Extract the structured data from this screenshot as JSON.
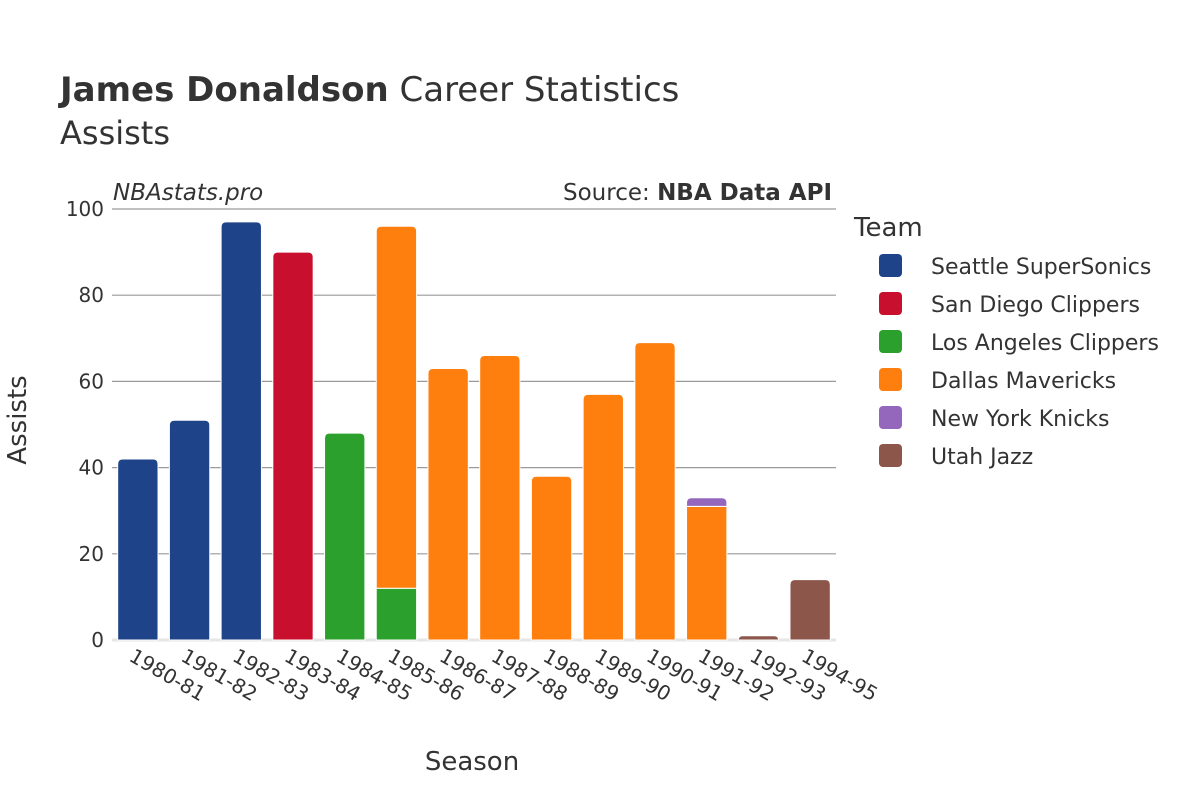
{
  "header": {
    "title_bold": "James Donaldson",
    "title_rest": " Career Statistics",
    "subtitle": "Assists",
    "watermark": "NBAstats.pro",
    "source_prefix": "Source: ",
    "source_name": "NBA Data API"
  },
  "legend": {
    "title": "Team"
  },
  "chart_data": {
    "type": "bar",
    "stacked": true,
    "title": "James Donaldson Career Statistics",
    "subtitle": "Assists",
    "xlabel": "Season",
    "ylabel": "Assists",
    "ylim": [
      0,
      100
    ],
    "yticks": [
      0,
      20,
      40,
      60,
      80,
      100
    ],
    "grid": true,
    "legend_position": "right",
    "categories": [
      "1980-81",
      "1981-82",
      "1982-83",
      "1983-84",
      "1984-85",
      "1985-86",
      "1986-87",
      "1987-88",
      "1988-89",
      "1989-90",
      "1990-91",
      "1991-92",
      "1992-93",
      "1994-95"
    ],
    "series": [
      {
        "name": "Seattle SuperSonics",
        "color": "#1f4388",
        "values": [
          42,
          51,
          97,
          0,
          0,
          0,
          0,
          0,
          0,
          0,
          0,
          0,
          0,
          0
        ]
      },
      {
        "name": "San Diego Clippers",
        "color": "#c8102e",
        "values": [
          0,
          0,
          0,
          90,
          0,
          0,
          0,
          0,
          0,
          0,
          0,
          0,
          0,
          0
        ]
      },
      {
        "name": "Los Angeles Clippers",
        "color": "#2ca02c",
        "values": [
          0,
          0,
          0,
          0,
          48,
          12,
          0,
          0,
          0,
          0,
          0,
          0,
          0,
          0
        ]
      },
      {
        "name": "Dallas Mavericks",
        "color": "#ff7f0e",
        "values": [
          0,
          0,
          0,
          0,
          0,
          84,
          63,
          66,
          38,
          57,
          69,
          31,
          0,
          0
        ]
      },
      {
        "name": "New York Knicks",
        "color": "#9467bd",
        "values": [
          0,
          0,
          0,
          0,
          0,
          0,
          0,
          0,
          0,
          0,
          0,
          2,
          0,
          0
        ]
      },
      {
        "name": "Utah Jazz",
        "color": "#8c564b",
        "values": [
          0,
          0,
          0,
          0,
          0,
          0,
          0,
          0,
          0,
          0,
          0,
          0,
          1,
          14
        ]
      }
    ]
  }
}
